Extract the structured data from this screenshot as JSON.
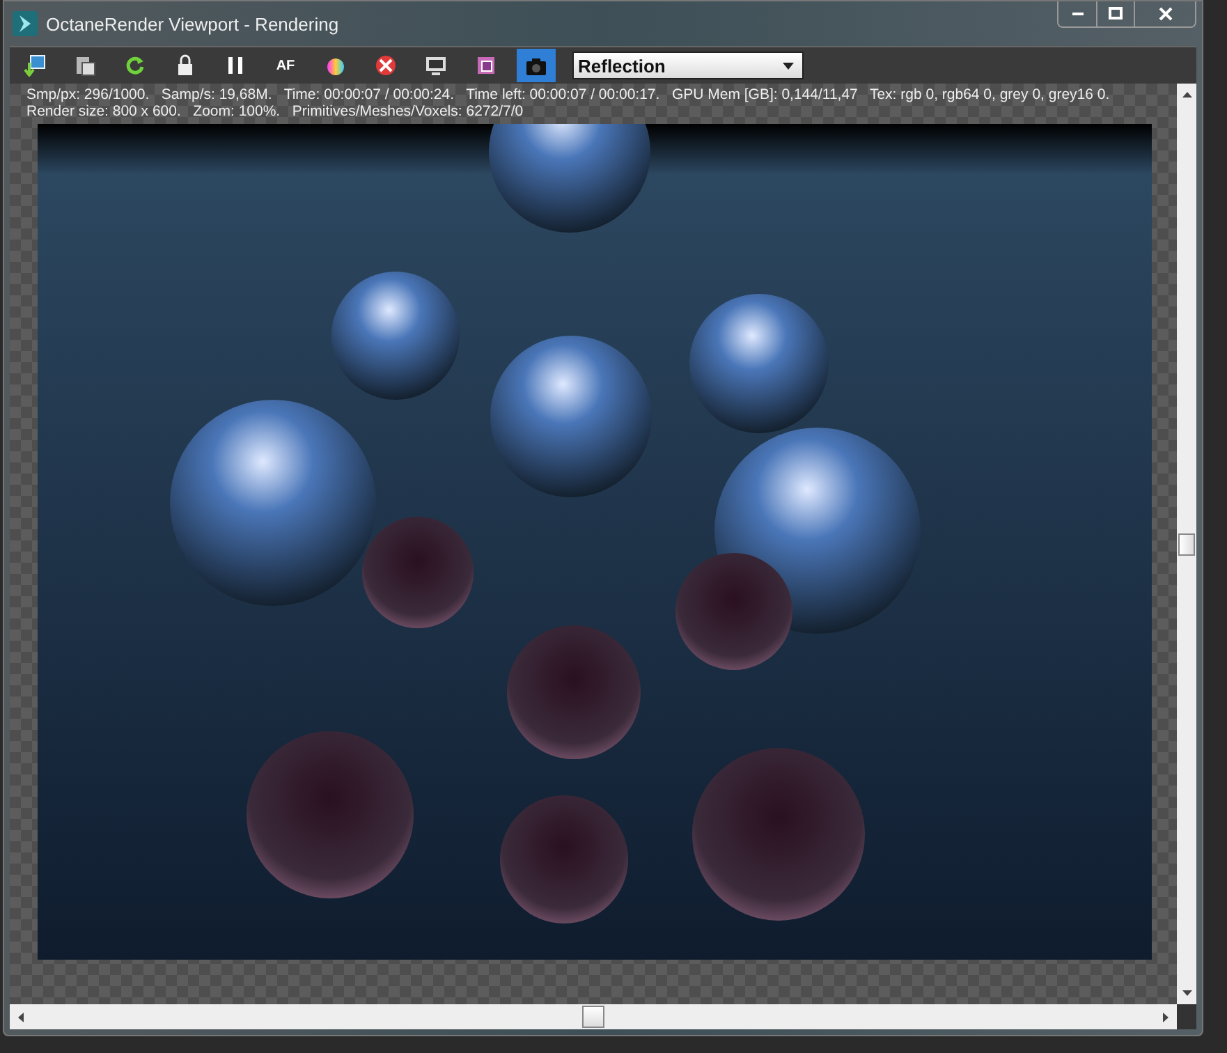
{
  "window": {
    "title": "OctaneRender Viewport - Rendering"
  },
  "toolbar": {
    "tools": [
      {
        "kind": "send",
        "selected": false
      },
      {
        "kind": "paste",
        "selected": false
      },
      {
        "kind": "restart",
        "selected": false
      },
      {
        "kind": "lock",
        "selected": false
      },
      {
        "kind": "pause",
        "selected": false
      },
      {
        "kind": "autofocus",
        "label": "AF",
        "selected": false
      },
      {
        "kind": "color",
        "selected": false
      },
      {
        "kind": "pick",
        "selected": false
      },
      {
        "kind": "display",
        "selected": false
      },
      {
        "kind": "region",
        "selected": false
      },
      {
        "kind": "camera",
        "selected": true
      }
    ],
    "mode_dropdown": {
      "value": "Reflection"
    }
  },
  "status": [
    "Smp/px: 296/1000.   Samp/s: 19,68M.   Time: 00:00:07 / 00:00:24.   Time left: 00:00:07 / 00:00:17.   GPU Mem [GB]: 0,144/11,47   Tex: rgb 0, rgb64 0, grey 0, grey16 0.",
    "Render size: 800 x 600.   Zoom: 100%.   Primitives/Meshes/Voxels: 6272/7/0"
  ]
}
